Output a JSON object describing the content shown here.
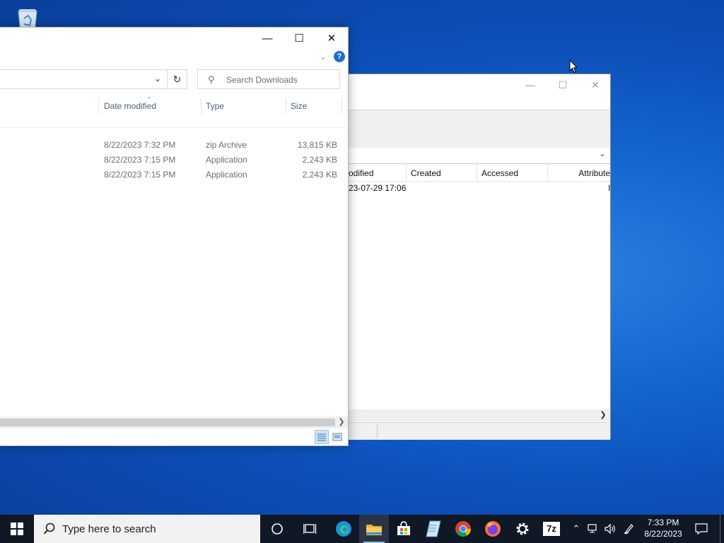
{
  "explorer": {
    "search_placeholder": "Search Downloads",
    "columns": {
      "date": "Date modified",
      "type": "Type",
      "size": "Size"
    },
    "rows": [
      {
        "date": "8/22/2023 7:32 PM",
        "type": "zip Archive",
        "size": "13,815 KB"
      },
      {
        "date": "8/22/2023 7:15 PM",
        "type": "Application",
        "size": "2,243 KB"
      },
      {
        "date": "8/22/2023 7:15 PM",
        "type": "Application",
        "size": "2,243 KB"
      }
    ]
  },
  "sevenzip": {
    "columns": {
      "modified": "odified",
      "created": "Created",
      "accessed": "Accessed",
      "attributes": "Attribute"
    },
    "row": {
      "modified": "23-07-29 17:06",
      "attributes": "I"
    }
  },
  "taskbar": {
    "search_placeholder": "Type here to search",
    "time": "7:33 PM",
    "date": "8/22/2023",
    "apps": [
      "task-view-icon",
      "edge-icon",
      "file-explorer-icon",
      "store-icon",
      "notepad-icon",
      "chrome-icon",
      "firefox-icon",
      "settings-icon",
      "7zip-icon"
    ]
  },
  "colors": {
    "desktop": "#1566cf",
    "taskbar": "#101725",
    "accent": "#0078d7"
  }
}
